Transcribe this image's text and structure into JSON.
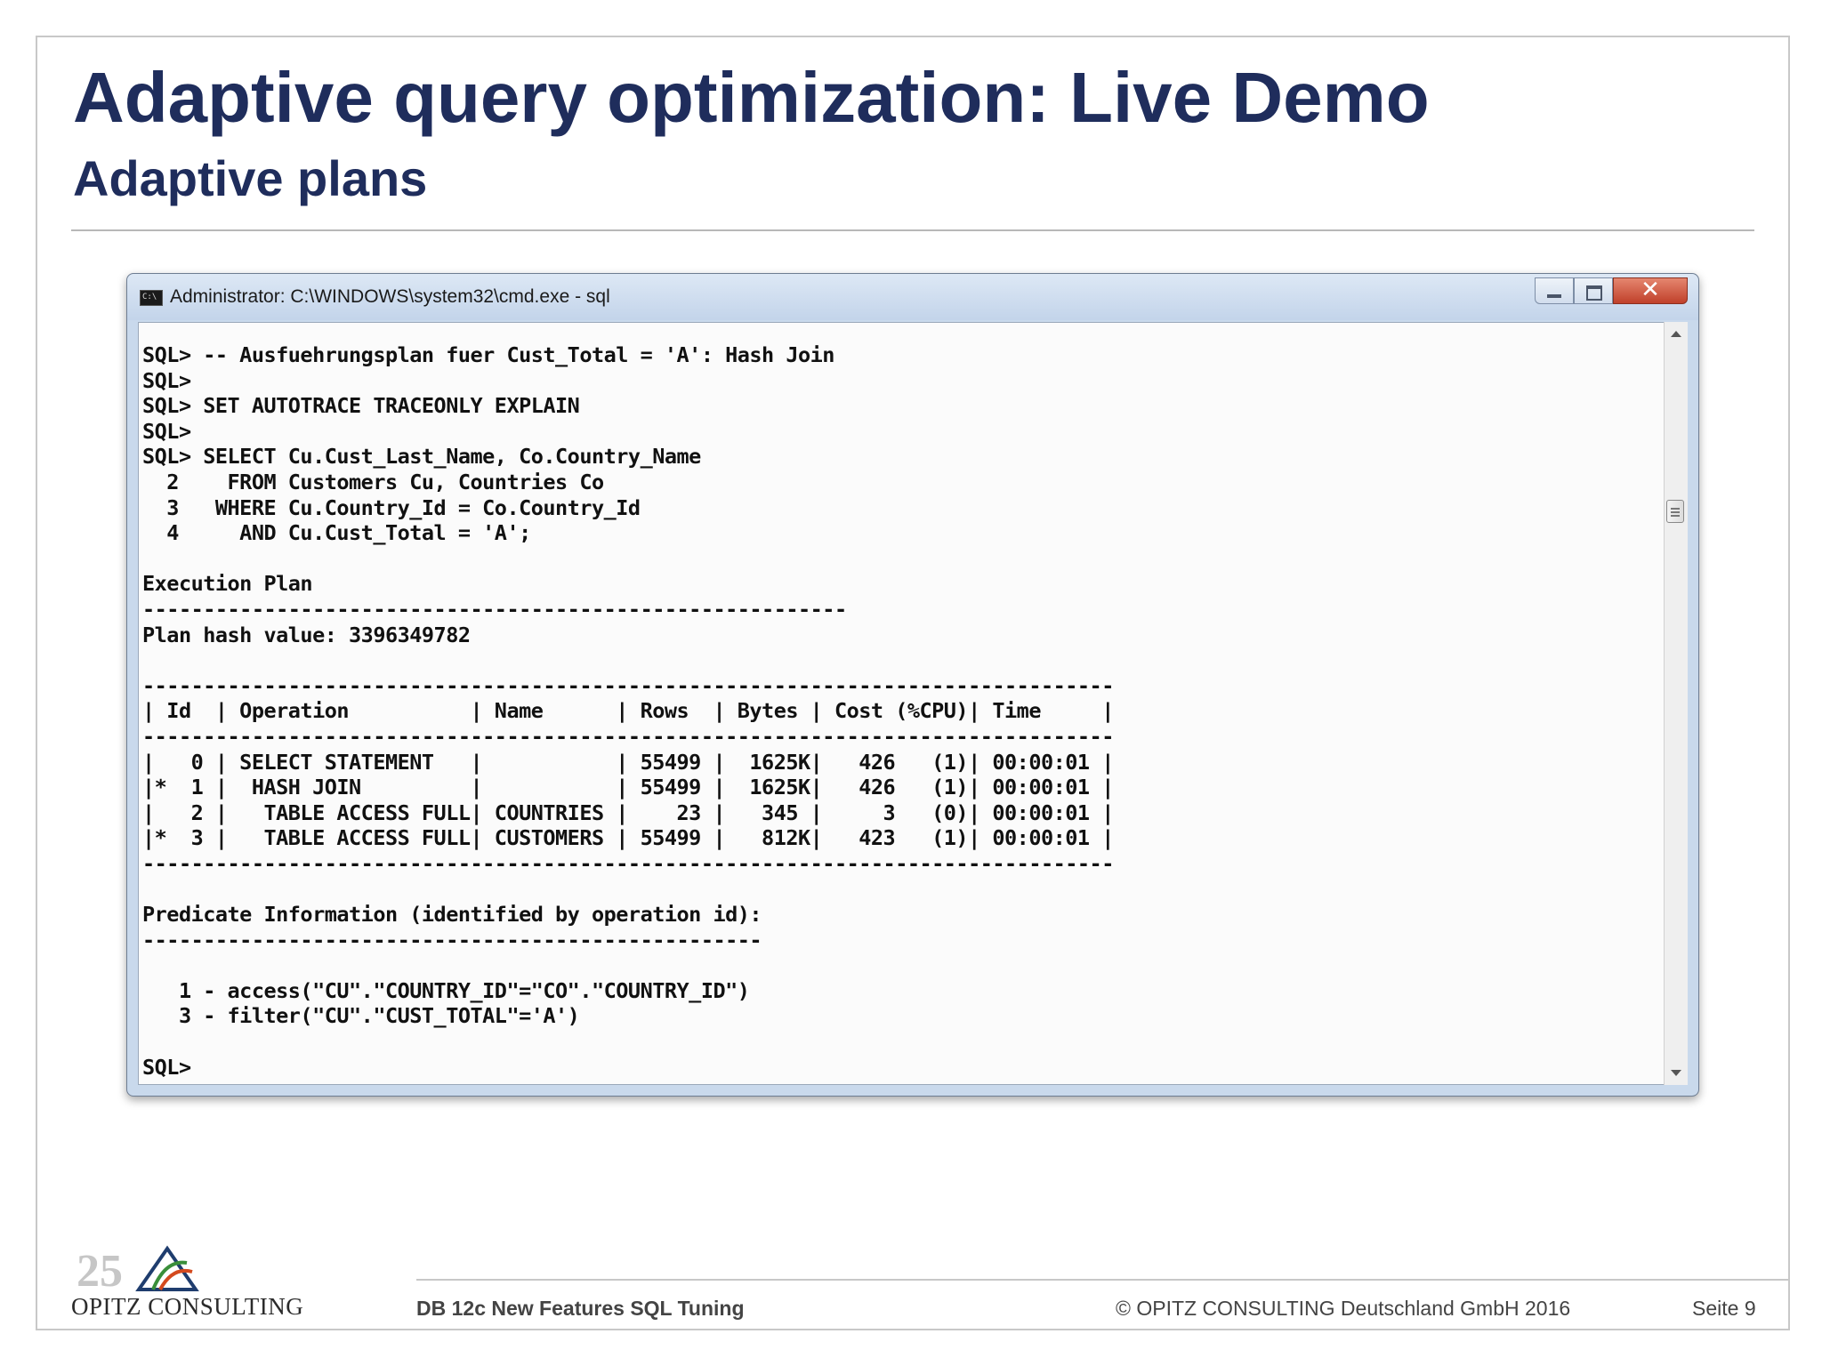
{
  "slide": {
    "title": "Adaptive query optimization: Live Demo",
    "subtitle": "Adaptive plans"
  },
  "window": {
    "title": "Administrator: C:\\WINDOWS\\system32\\cmd.exe - sql",
    "icon": "cmd-icon",
    "minimize_icon": "minimize-icon",
    "maximize_icon": "maximize-icon",
    "close_icon": "close-icon",
    "close_glyph": "✕"
  },
  "console": {
    "lines": [
      "SQL> -- Ausfuehrungsplan fuer Cust_Total = 'A': Hash Join",
      "SQL>",
      "SQL> SET AUTOTRACE TRACEONLY EXPLAIN",
      "SQL>",
      "SQL> SELECT Cu.Cust_Last_Name, Co.Country_Name",
      "  2    FROM Customers Cu, Countries Co",
      "  3   WHERE Cu.Country_Id = Co.Country_Id",
      "  4     AND Cu.Cust_Total = 'A';",
      "",
      "Execution Plan",
      "----------------------------------------------------------",
      "Plan hash value: 3396349782",
      "",
      "--------------------------------------------------------------------------------",
      "| Id  | Operation          | Name      | Rows  | Bytes | Cost (%CPU)| Time     |",
      "--------------------------------------------------------------------------------",
      "|   0 | SELECT STATEMENT   |           | 55499 |  1625K|   426   (1)| 00:00:01 |",
      "|*  1 |  HASH JOIN         |           | 55499 |  1625K|   426   (1)| 00:00:01 |",
      "|   2 |   TABLE ACCESS FULL| COUNTRIES |    23 |   345 |     3   (0)| 00:00:01 |",
      "|*  3 |   TABLE ACCESS FULL| CUSTOMERS | 55499 |   812K|   423   (1)| 00:00:01 |",
      "--------------------------------------------------------------------------------",
      "",
      "Predicate Information (identified by operation id):",
      "---------------------------------------------------",
      "",
      "   1 - access(\"CU\".\"COUNTRY_ID\"=\"CO\".\"COUNTRY_ID\")",
      "   3 - filter(\"CU\".\"CUST_TOTAL\"='A')",
      "",
      "SQL>"
    ]
  },
  "footer": {
    "logo_number": "25",
    "logo_text": "OPITZ CONSULTING",
    "course": "DB 12c New Features SQL Tuning",
    "copyright": "© OPITZ CONSULTING Deutschland GmbH 2016",
    "page": "Seite 9"
  }
}
